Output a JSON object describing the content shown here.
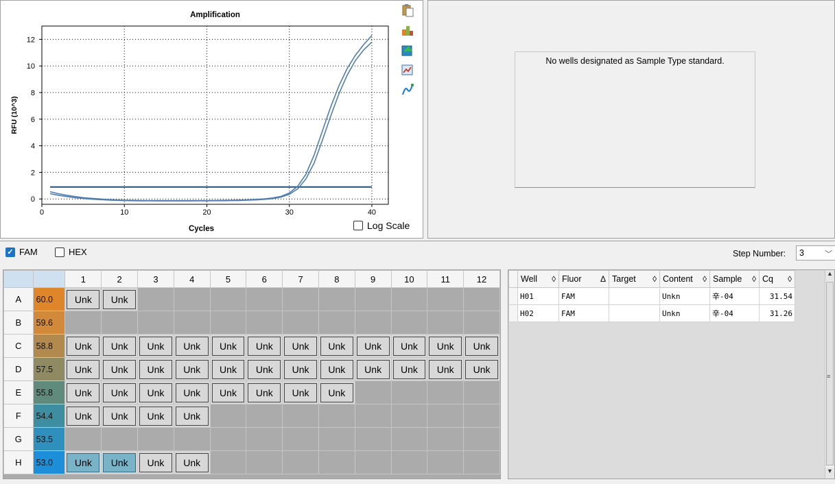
{
  "chart_data": {
    "type": "line",
    "title": "Amplification",
    "xlabel": "Cycles",
    "ylabel": "RFU (10^3)",
    "xlim": [
      0,
      42
    ],
    "ylim": [
      -0.4,
      13
    ],
    "xticks": [
      0,
      10,
      20,
      30,
      40
    ],
    "yticks": [
      0,
      2,
      4,
      6,
      8,
      10,
      12
    ],
    "grid": true,
    "series": [
      {
        "x": [
          1,
          2,
          3,
          4,
          5,
          6,
          7,
          8,
          9,
          10,
          11,
          12,
          13,
          14,
          15,
          16,
          17,
          18,
          19,
          20,
          21,
          22,
          23,
          24,
          25,
          26,
          27,
          28,
          29,
          30,
          31,
          32,
          33,
          34,
          35,
          36,
          37,
          38,
          39,
          40
        ],
        "values": [
          0.55,
          0.4,
          0.28,
          0.18,
          0.1,
          0.05,
          0.0,
          -0.04,
          -0.07,
          -0.09,
          -0.1,
          -0.11,
          -0.12,
          -0.12,
          -0.12,
          -0.12,
          -0.12,
          -0.12,
          -0.12,
          -0.11,
          -0.11,
          -0.1,
          -0.09,
          -0.08,
          -0.06,
          -0.03,
          0.01,
          0.08,
          0.2,
          0.45,
          0.95,
          1.85,
          3.3,
          5.1,
          6.9,
          8.5,
          9.8,
          10.8,
          11.6,
          12.3
        ]
      },
      {
        "x": [
          1,
          2,
          3,
          4,
          5,
          6,
          7,
          8,
          9,
          10,
          11,
          12,
          13,
          14,
          15,
          16,
          17,
          18,
          19,
          20,
          21,
          22,
          23,
          24,
          25,
          26,
          27,
          28,
          29,
          30,
          31,
          32,
          33,
          34,
          35,
          36,
          37,
          38,
          39,
          40
        ],
        "values": [
          0.4,
          0.28,
          0.18,
          0.1,
          0.04,
          -0.01,
          -0.05,
          -0.08,
          -0.1,
          -0.12,
          -0.13,
          -0.14,
          -0.14,
          -0.15,
          -0.15,
          -0.15,
          -0.15,
          -0.15,
          -0.14,
          -0.14,
          -0.13,
          -0.13,
          -0.12,
          -0.11,
          -0.09,
          -0.07,
          -0.03,
          0.03,
          0.14,
          0.35,
          0.75,
          1.5,
          2.7,
          4.4,
          6.2,
          7.9,
          9.3,
          10.4,
          11.2,
          11.8
        ]
      }
    ],
    "threshold": 0.9
  },
  "colors": {
    "curve": "#4f7db0",
    "threshold": "#1f4e79",
    "grid": "#000000"
  },
  "chart_icons": [
    "clipboard-icon",
    "export-image-icon",
    "export-data-icon",
    "chart-options-icon",
    "curve-icon"
  ],
  "log_scale": {
    "label": "Log Scale",
    "checked": false
  },
  "standard_curve": {
    "message": "No wells designated as Sample Type standard."
  },
  "fluors": [
    {
      "label": "FAM",
      "checked": true
    },
    {
      "label": "HEX",
      "checked": false
    }
  ],
  "step": {
    "label": "Step Number:",
    "value": "3"
  },
  "plate": {
    "columns": [
      "1",
      "2",
      "3",
      "4",
      "5",
      "6",
      "7",
      "8",
      "9",
      "10",
      "11",
      "12"
    ],
    "rows": [
      {
        "label": "A",
        "temp": "60.0",
        "color": "#e0862a",
        "wells": [
          "Unk",
          "Unk",
          "",
          "",
          "",
          "",
          "",
          "",
          "",
          "",
          "",
          ""
        ]
      },
      {
        "label": "B",
        "temp": "59.6",
        "color": "#d28a3a",
        "wells": [
          "",
          "",
          "",
          "",
          "",
          "",
          "",
          "",
          "",
          "",
          "",
          ""
        ]
      },
      {
        "label": "C",
        "temp": "58.8",
        "color": "#b28a4e",
        "wells": [
          "Unk",
          "Unk",
          "Unk",
          "Unk",
          "Unk",
          "Unk",
          "Unk",
          "Unk",
          "Unk",
          "Unk",
          "Unk",
          "Unk"
        ]
      },
      {
        "label": "D",
        "temp": "57.5",
        "color": "#8f8a62",
        "wells": [
          "Unk",
          "Unk",
          "Unk",
          "Unk",
          "Unk",
          "Unk",
          "Unk",
          "Unk",
          "Unk",
          "Unk",
          "Unk",
          "Unk"
        ]
      },
      {
        "label": "E",
        "temp": "55.8",
        "color": "#5f8a7c",
        "wells": [
          "Unk",
          "Unk",
          "Unk",
          "Unk",
          "Unk",
          "Unk",
          "Unk",
          "Unk",
          "",
          "",
          "",
          ""
        ]
      },
      {
        "label": "F",
        "temp": "54.4",
        "color": "#3c8ea0",
        "wells": [
          "Unk",
          "Unk",
          "Unk",
          "Unk",
          "",
          "",
          "",
          "",
          "",
          "",
          "",
          ""
        ]
      },
      {
        "label": "G",
        "temp": "53.5",
        "color": "#2f90bd",
        "wells": [
          "",
          "",
          "",
          "",
          "",
          "",
          "",
          "",
          "",
          "",
          "",
          ""
        ]
      },
      {
        "label": "H",
        "temp": "53.0",
        "color": "#1c8fd8",
        "wells": [
          "Unk",
          "Unk",
          "Unk",
          "Unk",
          "",
          "",
          "",
          "",
          "",
          "",
          "",
          ""
        ],
        "selected": [
          0,
          1
        ]
      }
    ]
  },
  "results": {
    "headers": [
      {
        "label": "Well",
        "sort": "◊"
      },
      {
        "label": "Fluor",
        "sort": "Δ"
      },
      {
        "label": "Target",
        "sort": "◊"
      },
      {
        "label": "Content",
        "sort": "◊"
      },
      {
        "label": "Sample",
        "sort": "◊"
      },
      {
        "label": "Cq",
        "sort": "◊"
      }
    ],
    "rows": [
      [
        "H01",
        "FAM",
        "",
        "Unkn",
        "辛-04",
        "31.54"
      ],
      [
        "H02",
        "FAM",
        "",
        "Unkn",
        "辛-04",
        "31.26"
      ]
    ]
  }
}
